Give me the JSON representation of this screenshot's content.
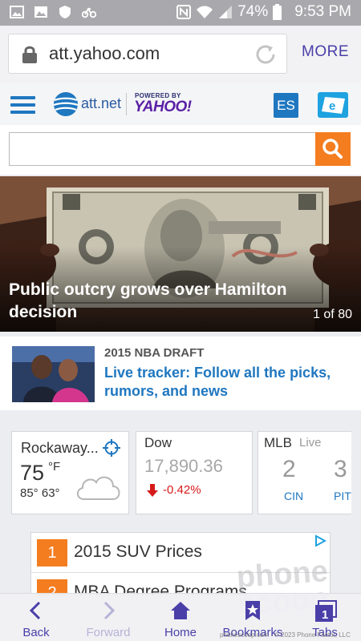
{
  "status_bar": {
    "battery": "74%",
    "time": "9:53 PM"
  },
  "browser": {
    "url": "att.yahoo.com",
    "more_label": "MORE"
  },
  "site_header": {
    "brand": "att.net",
    "powered_by": "POWERED BY",
    "partner": "YAHOO!",
    "language_button": "ES"
  },
  "search": {
    "placeholder": "",
    "value": ""
  },
  "hero": {
    "title": "Public outcry grows over Hamilton decision",
    "counter": "1 of 80"
  },
  "news": {
    "kicker": "2015 NBA DRAFT",
    "headline": "Live tracker: Follow all the picks, rumors, and news"
  },
  "weather": {
    "city": "Rockaway...",
    "temp": "75",
    "unit": "°F",
    "hi_lo": "85° 63°"
  },
  "stocks": {
    "name": "Dow",
    "value": "17,890.36",
    "change": "-0.42%"
  },
  "mlb": {
    "title": "MLB",
    "status": "Live",
    "score1": "2",
    "score2": "3",
    "team1": "CIN",
    "team2": "PIT"
  },
  "ads": [
    {
      "num": "1",
      "text": "2015 SUV Prices"
    },
    {
      "num": "2",
      "text": "MBA Degree Programs"
    }
  ],
  "bottom_nav": {
    "back": "Back",
    "forward": "Forward",
    "home": "Home",
    "bookmarks": "Bookmarks",
    "tabs": "Tabs",
    "tab_count": "1"
  },
  "watermark": {
    "line1": "phone",
    "line2": "scoop",
    "credit": "phonescoop.com · © 2023 Phone Factor, LLC"
  },
  "colors": {
    "accent_blue": "#1f77c0",
    "orange": "#f47d20",
    "purple": "#4a3fa8",
    "down_red": "#d51a1a"
  }
}
